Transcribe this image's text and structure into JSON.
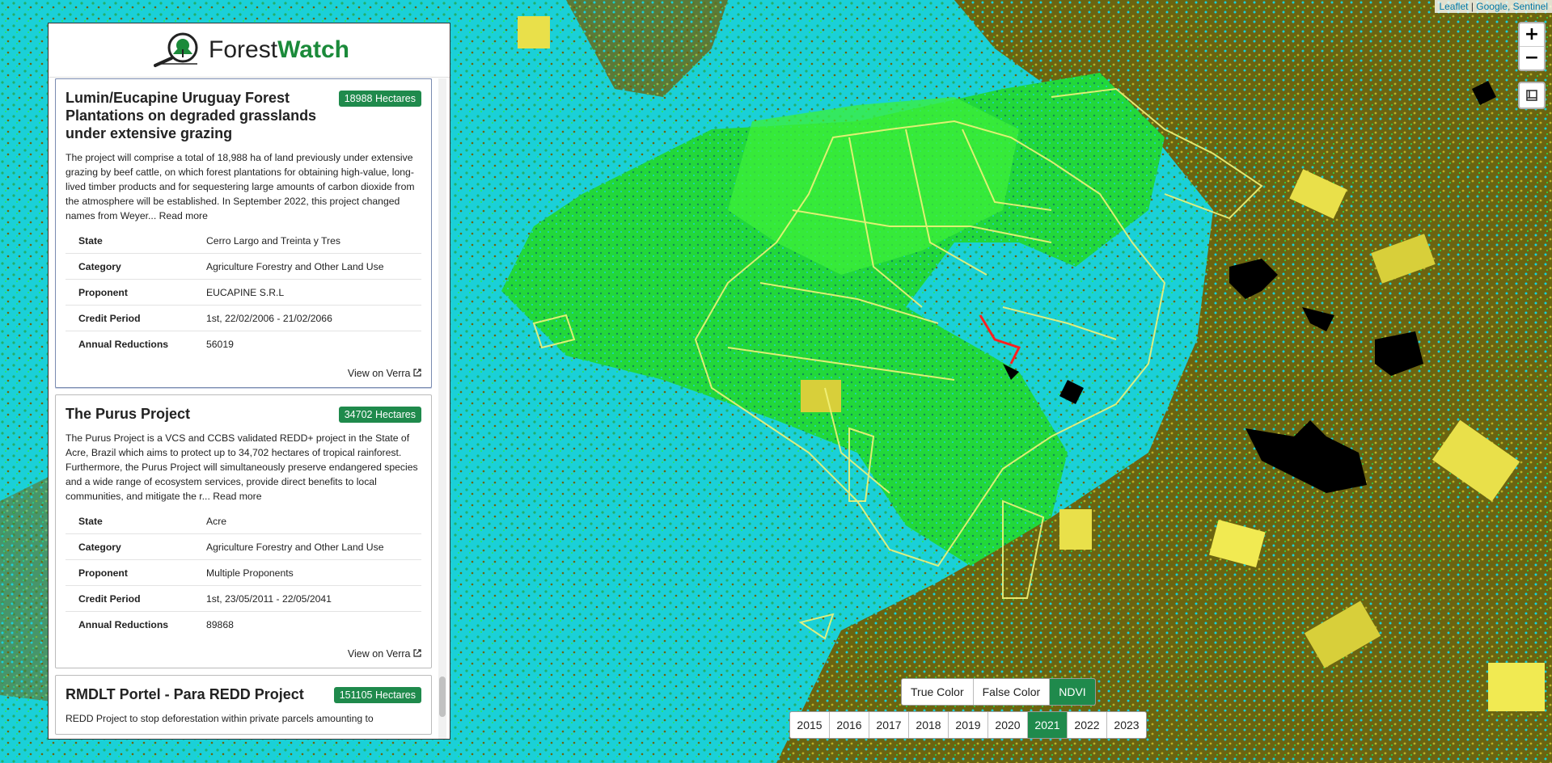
{
  "attribution": {
    "leaflet": "Leaflet",
    "rest": "Google, Sentinel"
  },
  "zoom": {
    "in": "+",
    "out": "−"
  },
  "logo": {
    "forest": "Forest",
    "watch": "Watch"
  },
  "projects": [
    {
      "title": "Lumin/Eucapine Uruguay Forest Plantations on degraded grasslands under extensive grazing",
      "hectares": "18988 Hectares",
      "description": "The project will comprise a total of 18,988 ha of land previously under extensive grazing by beef cattle, on which forest plantations for obtaining high-value, long-lived timber products and for sequestering large amounts of carbon dioxide from the atmosphere will be established. In September 2022, this project changed names from Weyer...",
      "read_more": "Read more",
      "fields": [
        {
          "k": "State",
          "v": "Cerro Largo and Treinta y Tres"
        },
        {
          "k": "Category",
          "v": "Agriculture Forestry and Other Land Use"
        },
        {
          "k": "Proponent",
          "v": "EUCAPINE S.R.L"
        },
        {
          "k": "Credit Period",
          "v": "1st, 22/02/2006 - 21/02/2066"
        },
        {
          "k": "Annual Reductions",
          "v": "56019"
        }
      ],
      "verra": "View on Verra"
    },
    {
      "title": "The Purus Project",
      "hectares": "34702 Hectares",
      "description": "The Purus Project is a VCS and CCBS validated REDD+ project in the State of Acre, Brazil which aims to protect up to 34,702 hectares of tropical rainforest. Furthermore, the Purus Project will simultaneously preserve endangered species and a wide range of ecosystem services, provide direct benefits to local communities, and mitigate the r...",
      "read_more": "Read more",
      "fields": [
        {
          "k": "State",
          "v": "Acre"
        },
        {
          "k": "Category",
          "v": "Agriculture Forestry and Other Land Use"
        },
        {
          "k": "Proponent",
          "v": "Multiple Proponents"
        },
        {
          "k": "Credit Period",
          "v": "1st, 23/05/2011 - 22/05/2041"
        },
        {
          "k": "Annual Reductions",
          "v": "89868"
        }
      ],
      "verra": "View on Verra"
    },
    {
      "title": "RMDLT Portel - Para REDD Project",
      "hectares": "151105 Hectares",
      "description": "REDD Project to stop deforestation within private parcels amounting to"
    }
  ],
  "view_modes": [
    "True Color",
    "False Color",
    "NDVI"
  ],
  "active_view": "NDVI",
  "years": [
    "2015",
    "2016",
    "2017",
    "2018",
    "2019",
    "2020",
    "2021",
    "2022",
    "2023"
  ],
  "active_year": "2021",
  "colors": {
    "accent": "#1f8a4c",
    "ndvi_cyan": "#1ad0d8",
    "ndvi_olive": "#6b6410",
    "ndvi_green": "#22e83a",
    "boundary": "#f2f27a"
  }
}
